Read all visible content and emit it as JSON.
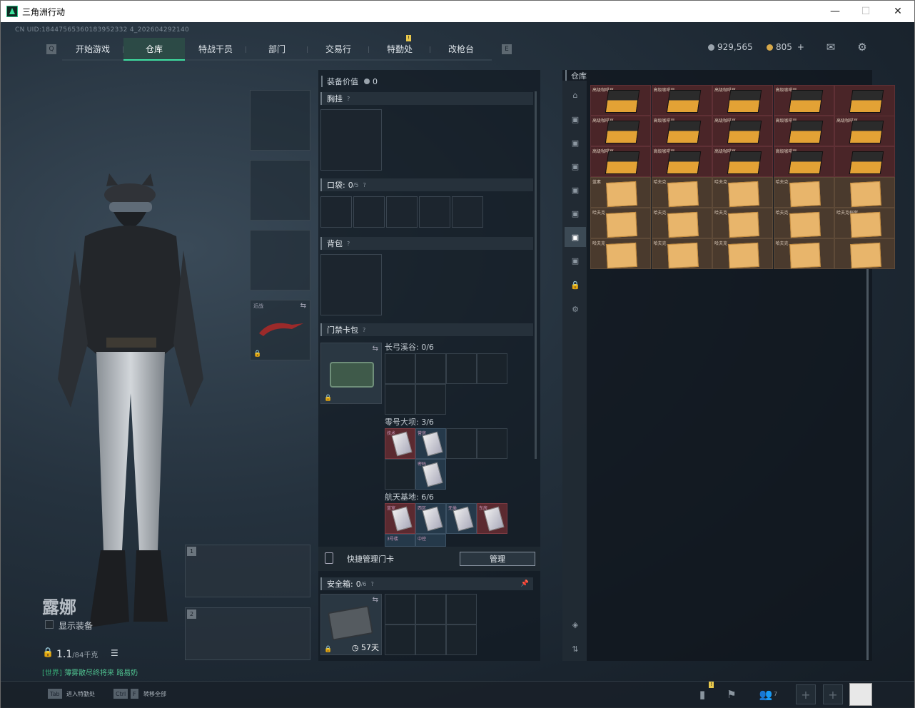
{
  "window": {
    "title": "三角洲行动",
    "min": "—",
    "max": "☐",
    "close": "✕"
  },
  "uid": "CN UID:18447565360183952332 4_202604292140",
  "nav": {
    "left_key": "Q",
    "right_key": "E",
    "tabs": [
      {
        "label": "开始游戏"
      },
      {
        "label": "仓库",
        "active": true
      },
      {
        "label": "特战干员"
      },
      {
        "label": "部门"
      },
      {
        "label": "交易行"
      },
      {
        "label": "特勤处",
        "badge": "!"
      },
      {
        "label": "改枪台"
      }
    ]
  },
  "currency": {
    "coins": "929,565",
    "tickets": "805",
    "plus": "+"
  },
  "header_icons": [
    "mail-icon",
    "gear-icon"
  ],
  "character": {
    "name": "露娜",
    "show_gear": "显示装备",
    "weight": "1.1",
    "weight_cap": "/84千克",
    "chat_channel": "[世界]",
    "chat_text": "薄雾散尽终将来 路易奶"
  },
  "gear_slots": [
    {
      "label": ""
    },
    {
      "label": ""
    },
    {
      "label": ""
    },
    {
      "label": "近战"
    }
  ],
  "weapon_slots": [
    {
      "num": "1"
    },
    {
      "num": "2"
    }
  ],
  "loadout": {
    "value_label": "装备价值",
    "value": "0",
    "chest": {
      "title": "胸挂",
      "q": "?"
    },
    "pocket": {
      "title": "口袋:",
      "count": "0",
      "cap": "/5",
      "q": "?"
    },
    "backpack": {
      "title": "背包",
      "q": "?"
    },
    "keycard": {
      "title": "门禁卡包",
      "q": "?"
    },
    "maps": [
      {
        "name": "长弓溪谷: 0/6"
      },
      {
        "name": "零号大坝: 3/6",
        "items": [
          "技术",
          "营房",
          "密码"
        ]
      },
      {
        "name": "航天基地: 6/6",
        "items": [
          "蓝室",
          "西区",
          "无类",
          "东房",
          "3号楼",
          "中控"
        ]
      }
    ],
    "quick_manage": "快捷管理门卡",
    "manage_btn": "管理",
    "safebox": {
      "title": "安全箱:",
      "count": "0",
      "cap": "/6",
      "q": "?",
      "days": "57天"
    }
  },
  "warehouse": {
    "title": "仓库",
    "items": [
      "高级咖啡豆",
      "高级咖啡豆",
      "高级咖啡豆",
      "高级咖啡豆",
      "",
      "高级咖啡豆",
      "高级咖啡豆",
      "高级咖啡豆",
      "高级咖啡豆",
      "高级咖啡豆",
      "高级咖啡豆",
      "高级咖啡豆",
      "高级咖啡豆",
      "高级咖啡豆",
      "",
      "蓝素",
      "哈夫克",
      "哈夫克",
      "哈夫克",
      "",
      "哈夫克",
      "哈夫克",
      "哈夫克",
      "哈夫克",
      "哈夫克档案",
      "哈夫克",
      "哈夫克",
      "哈夫克",
      "哈夫克",
      ""
    ]
  },
  "bottom": {
    "tab_key": "Tab",
    "tab_desc": "进入特勤处",
    "ctrl_key": "Ctrl",
    "f_key": "F",
    "ctrl_desc": "转移全部",
    "friends": "7",
    "badge": "!"
  }
}
